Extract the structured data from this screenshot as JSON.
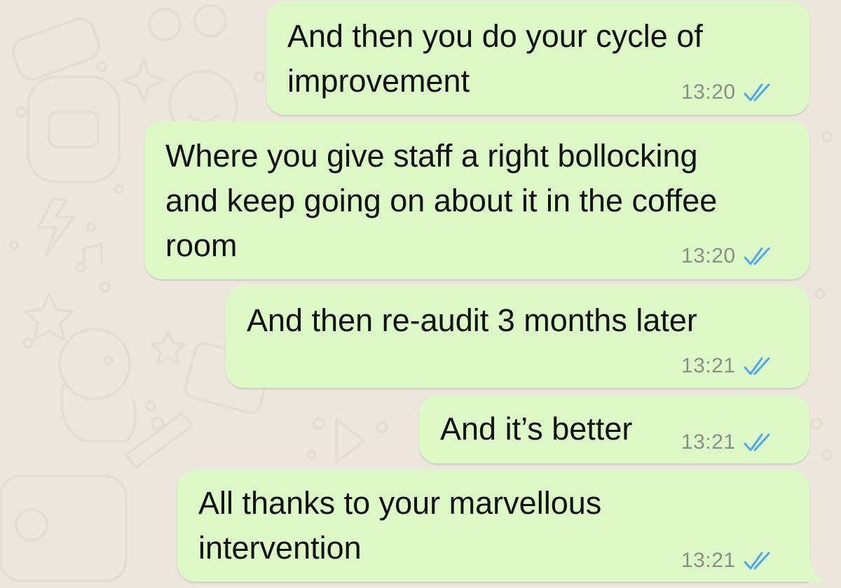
{
  "theme": {
    "outgoing_bubble_color": "#dcf8c6",
    "chat_background_color": "#ece6dd",
    "read_receipt_color": "#4fa6e8",
    "timestamp_color": "#8a8f86"
  },
  "messages": [
    {
      "lines": [
        "And then you do your cycle of",
        "improvement"
      ],
      "time": "13:20",
      "status_icon": "double-check-read-icon"
    },
    {
      "lines": [
        "Where you give staff a right bollocking",
        "and keep going on about it in the coffee",
        "room"
      ],
      "time": "13:20",
      "status_icon": "double-check-read-icon"
    },
    {
      "lines": [
        "And then re-audit 3 months later"
      ],
      "time": "13:21",
      "status_icon": "double-check-read-icon"
    },
    {
      "lines": [
        "And it’s better"
      ],
      "time": "13:21",
      "status_icon": "double-check-read-icon"
    },
    {
      "lines": [
        "All thanks to your marvellous",
        "intervention"
      ],
      "time": "13:21",
      "status_icon": "double-check-read-icon"
    }
  ]
}
